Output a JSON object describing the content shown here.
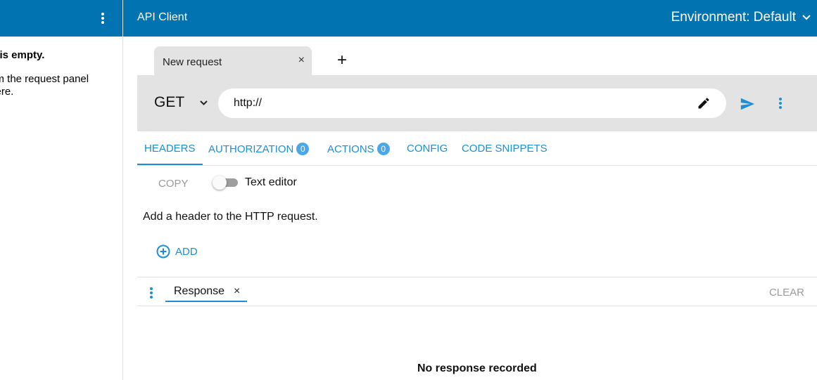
{
  "sidebar": {
    "empty_title": "st is empty.",
    "empty_text": "from the request panel\nr here."
  },
  "header": {
    "app_title": "API Client",
    "environment_label": "Environment: Default"
  },
  "tabs": [
    {
      "label": "New request",
      "close": "×"
    }
  ],
  "tab_add": "+",
  "request": {
    "method": "GET",
    "url": "http://"
  },
  "section_tabs": [
    {
      "label": "HEADERS",
      "active": true
    },
    {
      "label": "AUTHORIZATION",
      "badge": "0"
    },
    {
      "label": "ACTIONS",
      "badge": "0"
    },
    {
      "label": "CONFIG"
    },
    {
      "label": "CODE SNIPPETS"
    }
  ],
  "headers_panel": {
    "copy_label": "COPY",
    "toggle_label": "Text editor",
    "hint": "Add a header to the HTTP request.",
    "add_label": "ADD"
  },
  "response": {
    "tab_label": "Response",
    "tab_close": "×",
    "clear_label": "CLEAR",
    "empty_message": "No response recorded"
  },
  "colors": {
    "header_bg": "#0073b0",
    "accent": "#1a8fd6",
    "badge": "#4aa8e8",
    "panel_bg": "#e3e3e3"
  },
  "icons": {
    "sidebar_menu": "more-vert-icon",
    "env_dropdown": "chevron-down-icon",
    "method_dropdown": "chevron-down-icon",
    "url_edit": "pencil-icon",
    "send": "send-icon",
    "request_menu": "more-vert-icon",
    "add": "add-circle-icon",
    "response_menu": "more-vert-icon"
  }
}
